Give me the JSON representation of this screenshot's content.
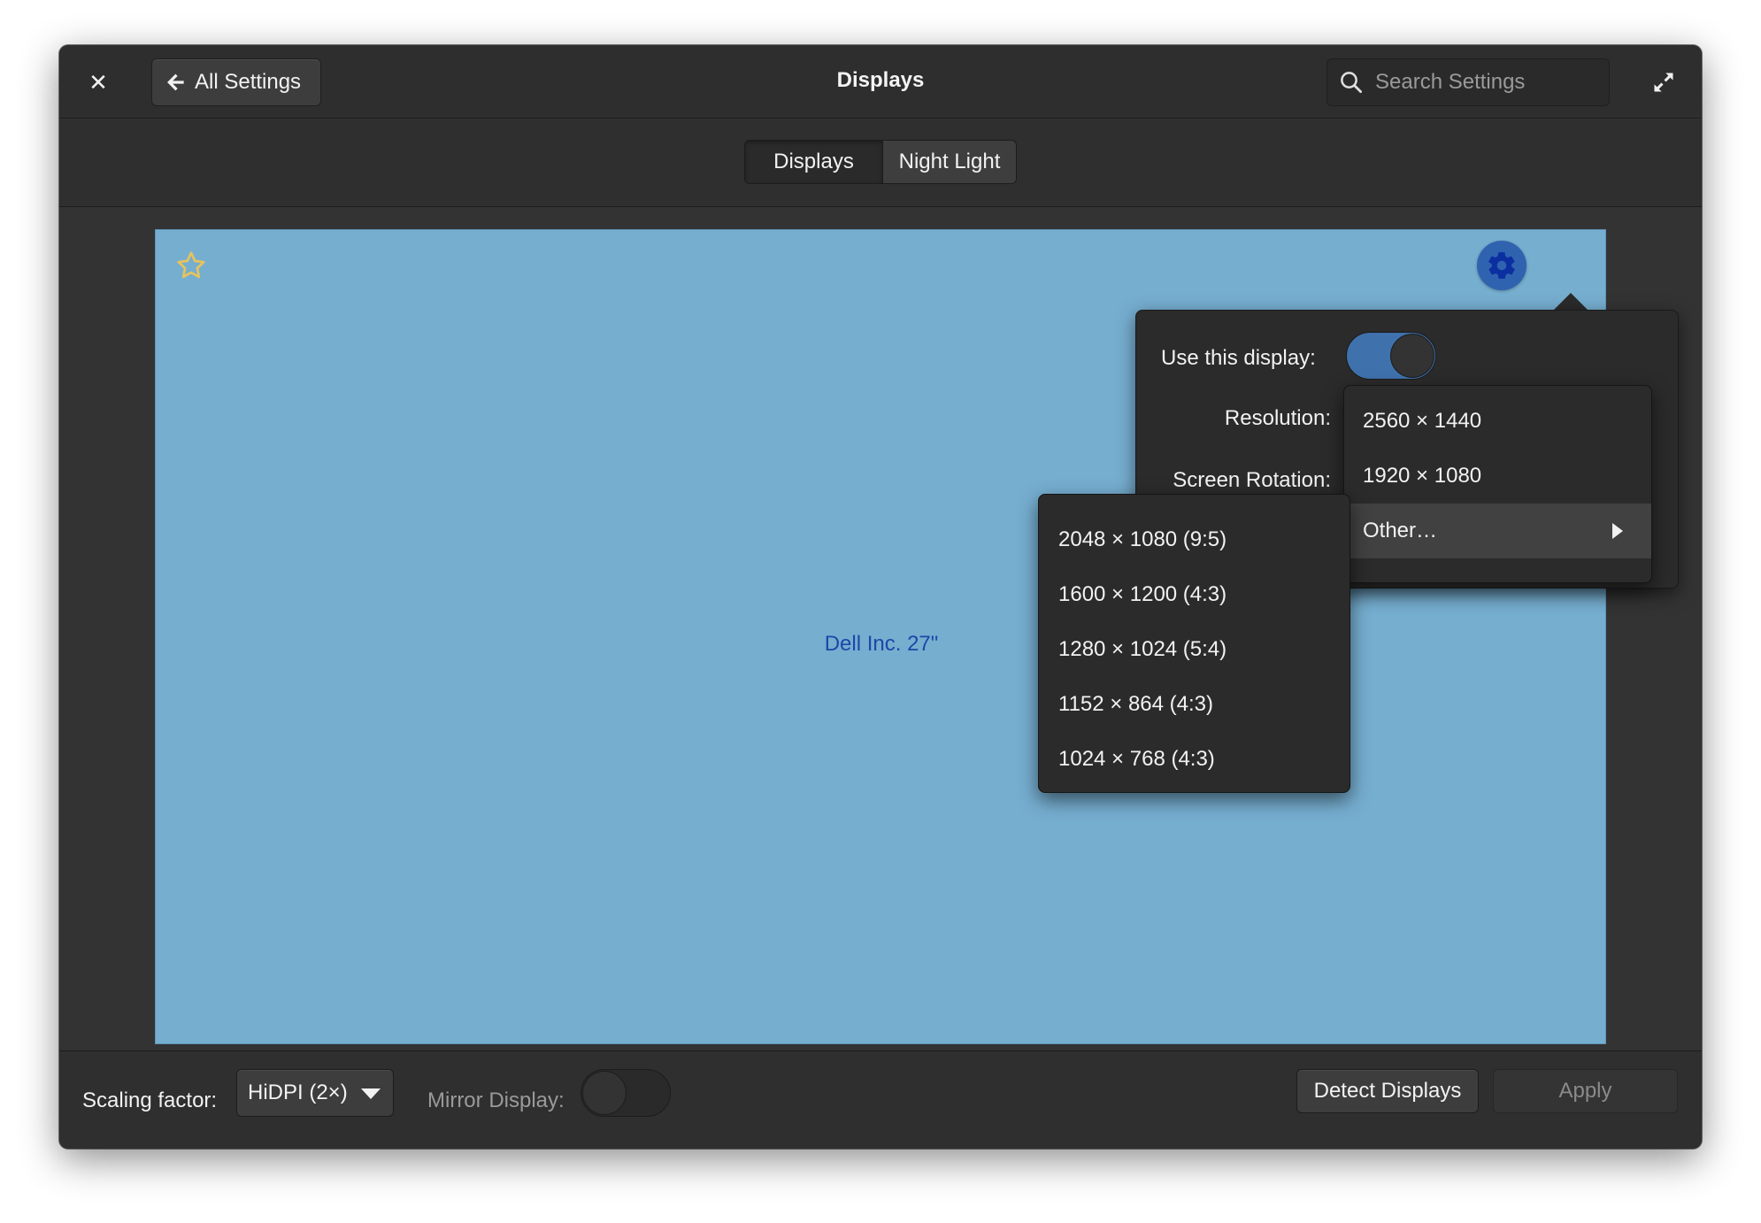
{
  "header": {
    "title": "Displays",
    "back_label": "All Settings",
    "search_placeholder": "Search Settings",
    "icons": [
      "close-icon",
      "back-arrow-icon",
      "search-icon",
      "maximize-icon"
    ]
  },
  "tabs": [
    {
      "label": "Displays",
      "active": true
    },
    {
      "label": "Night Light",
      "active": false
    }
  ],
  "display": {
    "name": "Dell Inc. 27\"",
    "background_color": "#76aed0",
    "is_primary": true,
    "icons": [
      "star-icon",
      "gear-icon"
    ]
  },
  "popover": {
    "use_display_label": "Use this display:",
    "use_display_on": true,
    "resolution_label": "Resolution:",
    "rotation_label": "Screen Rotation:"
  },
  "resolution_menu": {
    "items": [
      "2560 × 1440",
      "1920 × 1080",
      "Other…"
    ],
    "highlighted": "Other…"
  },
  "other_resolutions": [
    "2048 × 1080 (9:5)",
    "1600 × 1200 (4:3)",
    "1280 × 1024 (5:4)",
    "1152 × 864 (4:3)",
    "1024 × 768 (4:3)"
  ],
  "bottom": {
    "scaling_label": "Scaling factor:",
    "scaling_value": "HiDPI (2×)",
    "mirror_label": "Mirror Display:",
    "mirror_on": false,
    "detect_label": "Detect Displays",
    "apply_label": "Apply"
  },
  "colors": {
    "accent": "#3f72ad",
    "gear_background": "#2f63b0",
    "star": "#e6c35c",
    "display_name_text": "#1e47a8"
  }
}
